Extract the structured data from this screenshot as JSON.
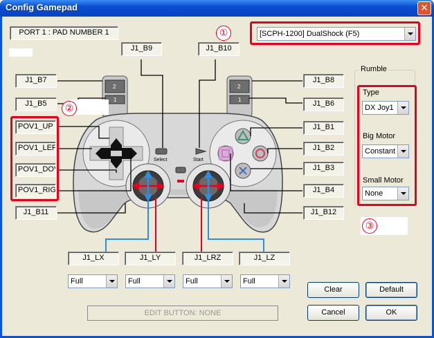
{
  "window": {
    "title": "Config Gamepad",
    "close_glyph": "✕"
  },
  "port_label": "PORT 1 : PAD NUMBER 1",
  "pad_type": {
    "selected": "[SCPH-1200] DualShock (F5)"
  },
  "annotations": {
    "one": "①",
    "two": "②",
    "three": "③"
  },
  "buttons": {
    "b9": "J1_B9",
    "b10": "J1_B10",
    "b7": "J1_B7",
    "b5": "J1_B5",
    "b8": "J1_B8",
    "b6": "J1_B6",
    "b1": "J1_B1",
    "b2": "J1_B2",
    "b3": "J1_B3",
    "b4": "J1_B4",
    "b11": "J1_B11",
    "b12": "J1_B12"
  },
  "pov": {
    "up": "POV1_UP",
    "left": "POV1_LEF",
    "down": "POV1_DOV",
    "right": "POV1_RIG"
  },
  "axes": {
    "lx": "J1_LX",
    "ly": "J1_LY",
    "lrz": "J1_LRZ",
    "lz": "J1_LZ"
  },
  "axis_modes": {
    "lx": "Full",
    "ly": "Full",
    "lrz": "Full",
    "lz": "Full"
  },
  "pad_labels": {
    "select": "Select",
    "start": "Start",
    "l2": "2",
    "l1": "1",
    "r2": "2",
    "r1": "1"
  },
  "rumble": {
    "title": "Rumble",
    "type_label": "Type",
    "type_value": "DX Joy1",
    "big_label": "Big Motor",
    "big_value": "Constant",
    "small_label": "Small Motor",
    "small_value": "None"
  },
  "edit_status": "EDIT BUTTON: NONE",
  "actions": {
    "clear": "Clear",
    "default": "Default",
    "cancel": "Cancel",
    "ok": "OK"
  },
  "colors": {
    "accent_red": "#e8001c",
    "titlebar": "#0a52d6",
    "axis_blue": "#2a8fe0"
  }
}
